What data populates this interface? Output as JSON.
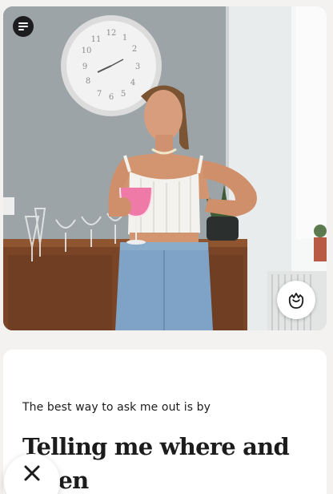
{
  "photo": {
    "description_icon": "photo-of-woman-holding-pink-drink",
    "menu_icon": "menu-lines-icon",
    "like_icon": "rose-like-icon"
  },
  "prompt": {
    "question": "The best way to ask me out is by",
    "answer": "Telling me where and when"
  },
  "actions": {
    "skip_icon": "close-x-icon"
  },
  "colors": {
    "background": "#f4f2f0",
    "card": "#ffffff",
    "text": "#1c1c1c",
    "menu_button": "#1d1d1f"
  }
}
